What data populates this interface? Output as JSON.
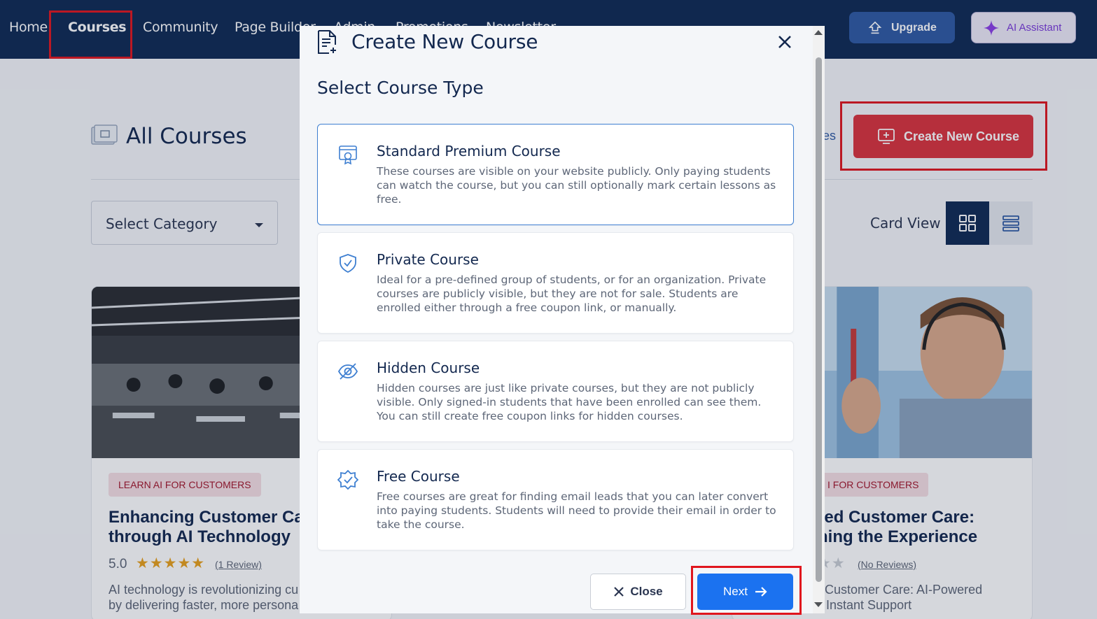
{
  "nav": {
    "items": [
      {
        "label": "Home"
      },
      {
        "label": "Courses"
      },
      {
        "label": "Community"
      },
      {
        "label": "Page Builder"
      },
      {
        "label": "Admin"
      },
      {
        "label": "Promotions"
      },
      {
        "label": "Newsletter"
      }
    ],
    "upgrade_label": "Upgrade",
    "ai_label": "AI Assistant",
    "icons": {
      "upgrade": "upload-arrow-icon",
      "ai": "sparkle-icon"
    },
    "colors": {
      "bar": "#0f2a54",
      "upgrade": "#2f5aa3",
      "ai_accent": "#7a3bd8"
    }
  },
  "page": {
    "title": "All Courses",
    "create_label": "Create New Course",
    "bg_link_fragment": "es",
    "category_placeholder": "Select Category",
    "view_label": "Card View",
    "colors": {
      "create": "#d9323c",
      "highlight": "#e0161e"
    }
  },
  "cards": [
    {
      "tag": "LEARN AI FOR CUSTOMERS",
      "title_line1": "Enhancing Customer Ca",
      "title_line2": "through AI Technology",
      "rating": "5.0",
      "stars": "★★★★★",
      "reviews": "(1 Review)",
      "desc_line1": "AI technology is revolutionizing cu",
      "desc_line2": "by delivering faster, more persona"
    },
    {
      "tag": "I FOR CUSTOMERS",
      "title_line1": "red Customer Care:",
      "title_line2": "ning the Experience",
      "stars": "★★",
      "reviews": "(No Reviews)",
      "desc_line1": "f Customer Care: AI-Powered",
      "desc_line2": "Instant Support"
    }
  ],
  "modal": {
    "title": "Create New Course",
    "subtitle": "Select Course Type",
    "options": [
      {
        "title": "Standard Premium Course",
        "desc": "These courses are visible on your website publicly. Only paying students can watch the course, but you can still optionally mark certain lessons as free.",
        "icon": "certificate-icon",
        "selected": true
      },
      {
        "title": "Private Course",
        "desc": "Ideal for a pre-defined group of students, or for an organization. Private courses are publicly visible, but they are not for sale. Students are enrolled either through a free coupon link, or manually.",
        "icon": "shield-check-icon"
      },
      {
        "title": "Hidden Course",
        "desc": "Hidden courses are just like private courses, but they are not publicly visible. Only signed-in students that have been enrolled can see them. You can still create free coupon links for hidden courses.",
        "icon": "eye-off-icon"
      },
      {
        "title": "Free Course",
        "desc": "Free courses are great for finding email leads that you can later convert into paying students. Students will need to provide their email in order to take the course.",
        "icon": "badge-check-icon"
      }
    ],
    "close_label": "Close",
    "next_label": "Next",
    "colors": {
      "next": "#1b72f0",
      "selected_border": "#3e7fd1"
    }
  }
}
